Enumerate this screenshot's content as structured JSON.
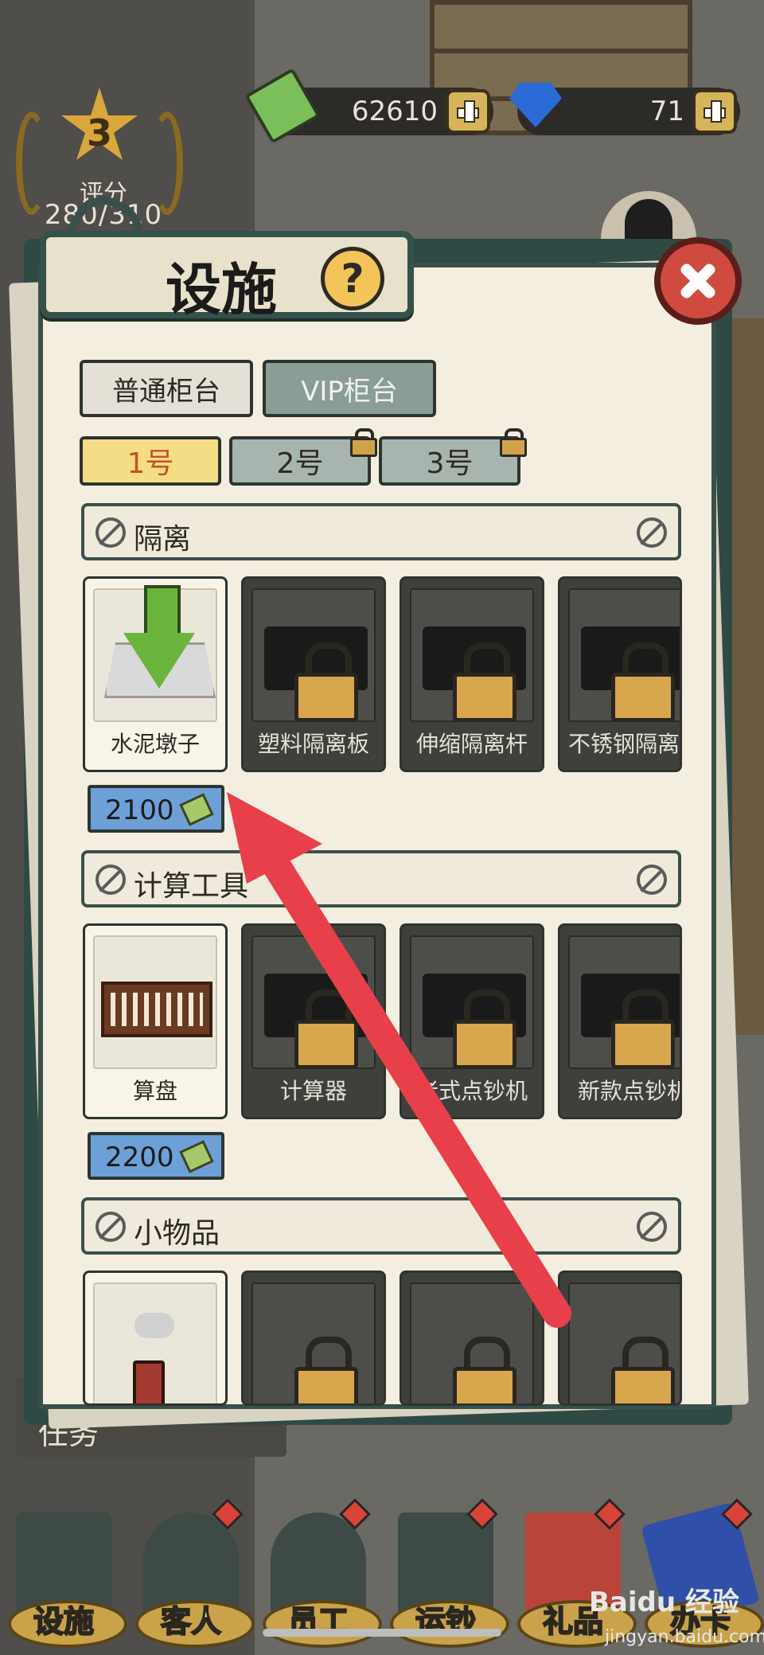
{
  "top_bar": {
    "money_value": "62610",
    "gem_value": "71"
  },
  "score": {
    "rank": "3",
    "label": "评分",
    "points": "280/310"
  },
  "panel": {
    "title": "设施",
    "help_glyph": "?"
  },
  "counter_tabs": [
    {
      "label": "普通柜台",
      "active": false
    },
    {
      "label": "VIP柜台",
      "active": true
    }
  ],
  "number_tabs": [
    {
      "label": "1号",
      "locked": false,
      "active": true
    },
    {
      "label": "2号",
      "locked": true,
      "active": false
    },
    {
      "label": "3号",
      "locked": true,
      "active": false
    }
  ],
  "sections": [
    {
      "name": "隔离",
      "items": [
        {
          "label": "水泥墩子",
          "locked": false,
          "icon": "cement-block-icon"
        },
        {
          "label": "塑料隔离板",
          "locked": true,
          "icon": "plastic-barrier-icon"
        },
        {
          "label": "伸缩隔离杆",
          "locked": true,
          "icon": "retractable-barrier-icon"
        },
        {
          "label": "不锈钢隔离杆",
          "locked": true,
          "icon": "steel-barrier-icon"
        }
      ],
      "price": "2100"
    },
    {
      "name": "计算工具",
      "items": [
        {
          "label": "算盘",
          "locked": false,
          "icon": "abacus-icon"
        },
        {
          "label": "计算器",
          "locked": true,
          "icon": "calculator-icon"
        },
        {
          "label": "老式点钞机",
          "locked": true,
          "icon": "old-counter-icon"
        },
        {
          "label": "新款点钞机",
          "locked": true,
          "icon": "new-counter-icon"
        }
      ],
      "price": "2200"
    },
    {
      "name": "小物品",
      "items": [
        {
          "label": "",
          "locked": false,
          "icon": "stamp-icon"
        },
        {
          "label": "",
          "locked": true,
          "icon": "item-icon"
        },
        {
          "label": "",
          "locked": true,
          "icon": "item-icon"
        },
        {
          "label": "",
          "locked": true,
          "icon": "phone-icon"
        }
      ]
    }
  ],
  "side_task": {
    "label": "任务"
  },
  "bottom_nav": [
    {
      "label": "设施",
      "icon": "atm-icon"
    },
    {
      "label": "客人",
      "icon": "customer-icon"
    },
    {
      "label": "员工",
      "icon": "employee-icon"
    },
    {
      "label": "运钞",
      "icon": "van-icon"
    },
    {
      "label": "礼品",
      "icon": "gift-bag-icon"
    },
    {
      "label": "办卡",
      "icon": "bank-card-icon"
    }
  ],
  "watermark": {
    "brand": "Baidu 经验",
    "url": "jingyan.baidu.com"
  },
  "colors": {
    "panel_border": "#3a4f4a",
    "active_tab": "#f5dd86",
    "locked_card": "#3f403c",
    "price_badge": "#6ea0d8",
    "close_button": "#d04a3f",
    "annotation_arrow": "#e8404a"
  }
}
